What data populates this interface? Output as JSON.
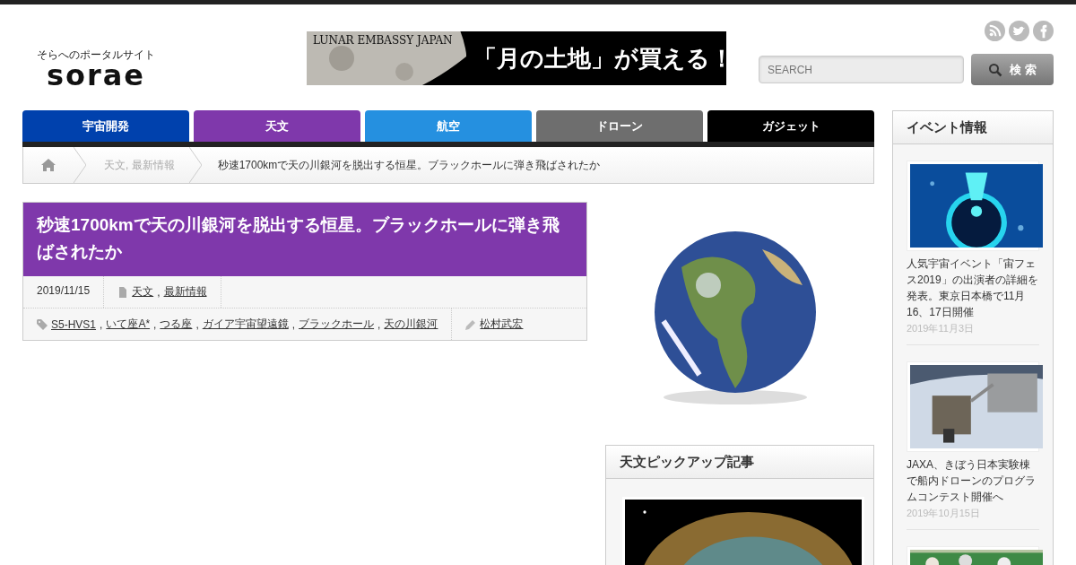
{
  "logo": {
    "tagline": "そらへのポータルサイト",
    "name": "sorae"
  },
  "banner": {
    "brand": "LUNAR EMBASSY JAPAN",
    "headline": "「月の土地」が買える！"
  },
  "search": {
    "placeholder": "SEARCH",
    "button": "検 索"
  },
  "nav": [
    {
      "label": "宇宙開発",
      "color": "#0041ad"
    },
    {
      "label": "天文",
      "color": "#7f38ab"
    },
    {
      "label": "航空",
      "color": "#2590e0"
    },
    {
      "label": "ドローン",
      "color": "#6e6e6e"
    },
    {
      "label": "ガジェット",
      "color": "#000000"
    }
  ],
  "breadcrumb": {
    "category": "天文, 最新情報",
    "current": "秒速1700kmで天の川銀河を脱出する恒星。ブラックホールに弾き飛ばされたか"
  },
  "article": {
    "title": "秒速1700kmで天の川銀河を脱出する恒星。ブラックホールに弾き飛ばされたか",
    "date": "2019/11/15",
    "categories": [
      "天文",
      "最新情報"
    ],
    "tags": [
      "S5-HVS1",
      "いて座A*",
      "つる座",
      "ガイア宇宙望遠鏡",
      "ブラックホール",
      "天の川銀河"
    ],
    "author": "松村武宏",
    "separator": ","
  },
  "pickup": {
    "title": "天文ピックアップ記事"
  },
  "events": {
    "title": "イベント情報",
    "items": [
      {
        "title": "人気宇宙イベント「宙フェス2019」の出演者の詳細を発表。東京日本橋で11月16、17日開催",
        "date": "2019年11月3日"
      },
      {
        "title": "JAXA、きぼう日本実験棟で船内ドローンのプログラムコンテスト開催へ",
        "date": "2019年10月15日"
      }
    ]
  }
}
